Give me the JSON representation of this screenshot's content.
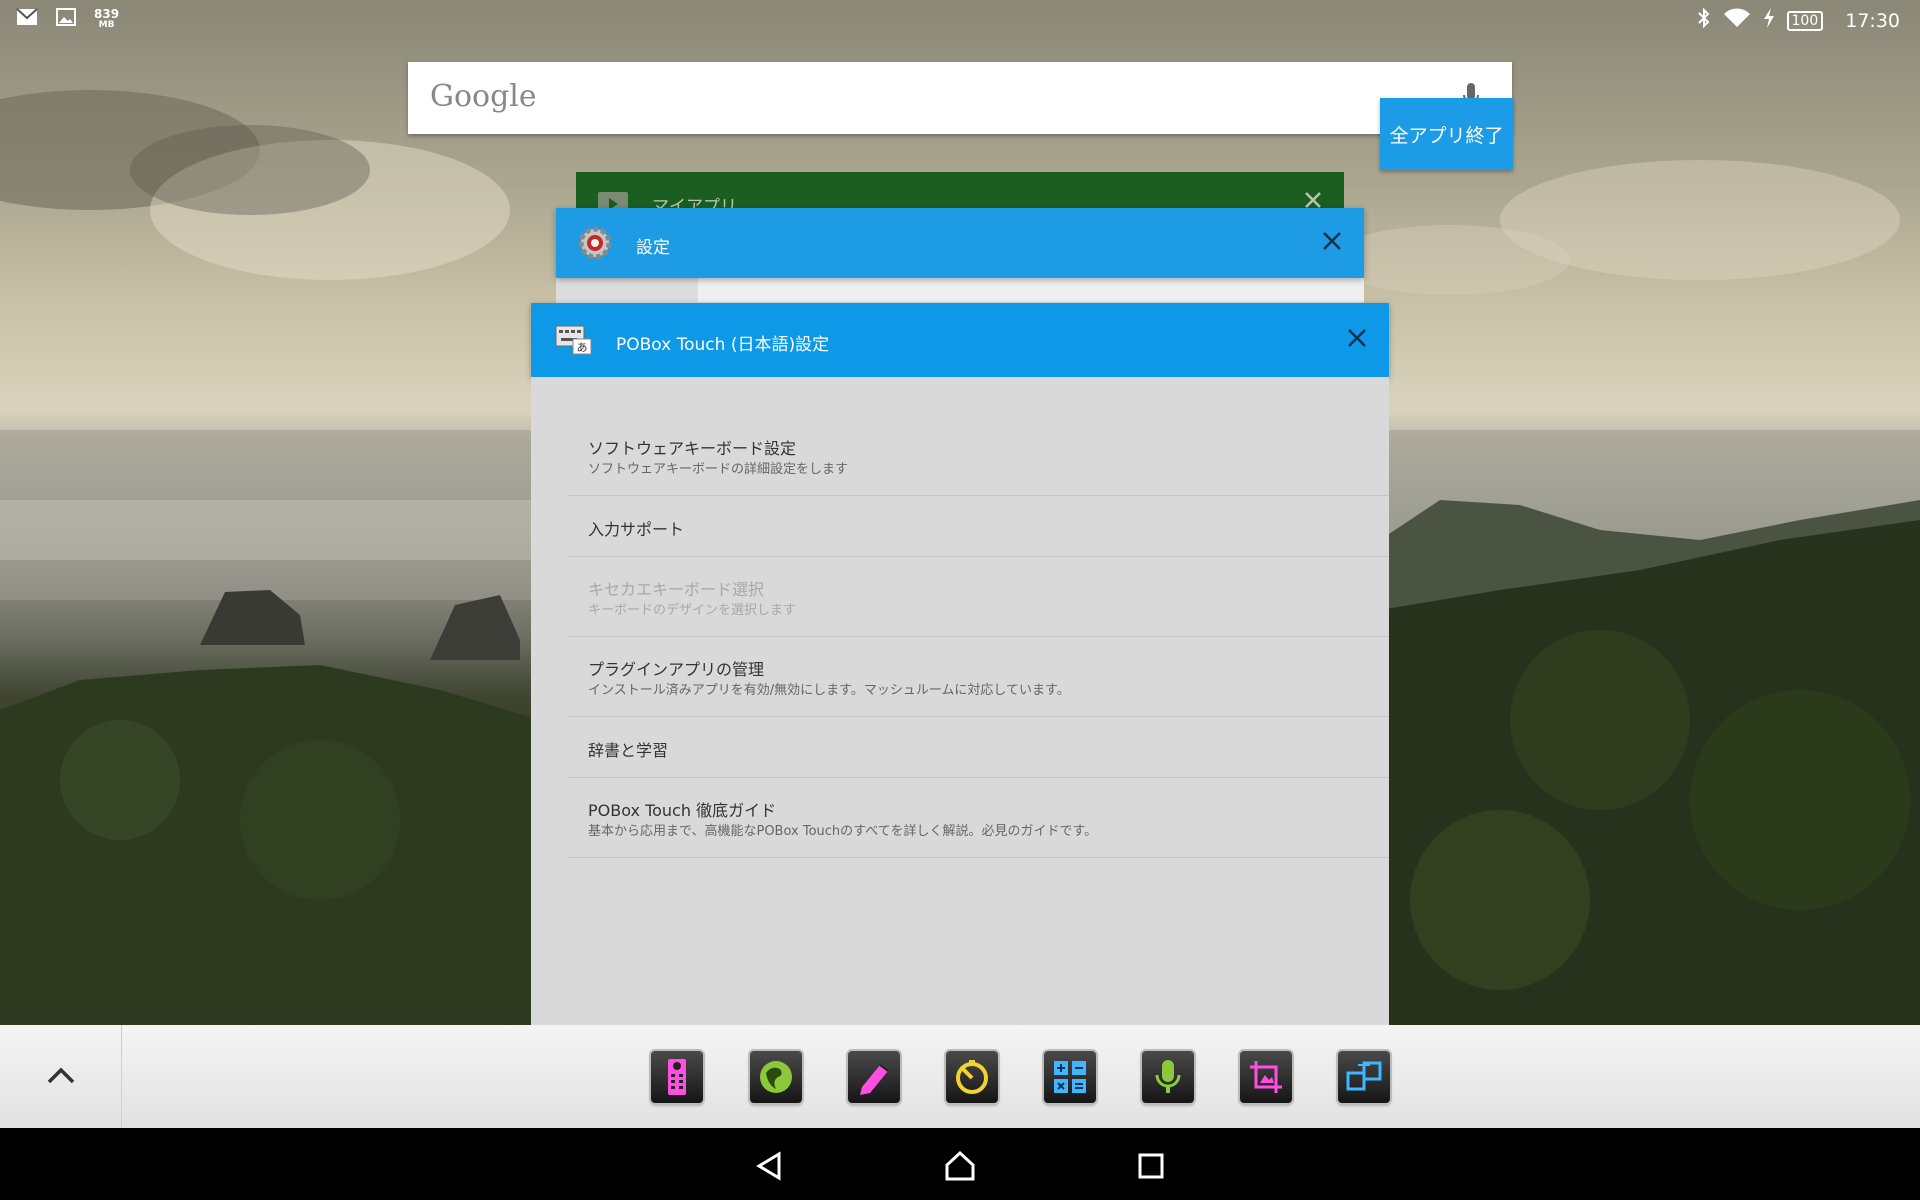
{
  "status_bar": {
    "memory_value": "839",
    "memory_unit": "MB",
    "battery": "100",
    "time": "17:30"
  },
  "search": {
    "logo": "Google"
  },
  "recents": {
    "close_all_label": "全アプリ終了",
    "cards": [
      {
        "title": "マイアプリ"
      },
      {
        "title": "設定"
      },
      {
        "title": "POBox Touch (日本語)設定"
      }
    ]
  },
  "pobox_settings": {
    "items": [
      {
        "title": "ソフトウェアキーボード設定",
        "summary": "ソフトウェアキーボードの詳細設定をします"
      },
      {
        "title": "入力サポート",
        "summary": ""
      },
      {
        "title": "キセカエキーボード選択",
        "summary": "キーボードのデザインを選択します"
      },
      {
        "title": "プラグインアプリの管理",
        "summary": "インストール済みアプリを有効/無効にします。マッシュルームに対応しています。"
      },
      {
        "title": "辞書と学習",
        "summary": ""
      },
      {
        "title": "POBox Touch 徹底ガイド",
        "summary": "基本から応用まで、高機能なPOBox Touchのすべてを詳しく解説。必見のガイドです。"
      }
    ]
  },
  "icons": {
    "status": [
      "gmail-icon",
      "gallery-icon",
      "bluetooth-icon",
      "wifi-icon",
      "charging-icon",
      "battery-icon"
    ],
    "dock": [
      "remote-icon",
      "browser-icon",
      "note-icon",
      "timer-icon",
      "calculator-icon",
      "voice-recorder-icon",
      "capture-icon",
      "add-smallapp-icon"
    ],
    "nav": [
      "back-icon",
      "home-icon",
      "recents-icon"
    ]
  },
  "colors": {
    "accent": "#0d98e8",
    "myapps_header": "#1b5e20"
  }
}
